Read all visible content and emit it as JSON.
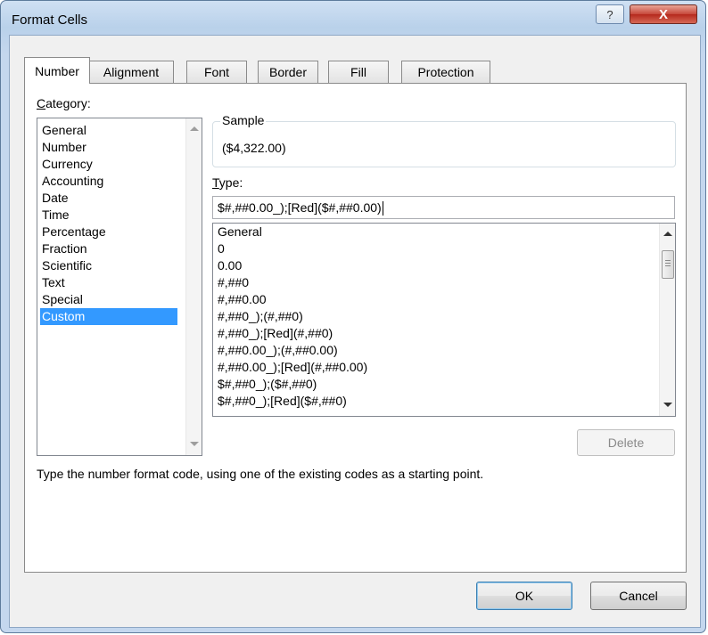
{
  "window": {
    "title": "Format Cells",
    "help_label": "?",
    "close_label": "X"
  },
  "tabs": [
    {
      "label": "Number",
      "active": true
    },
    {
      "label": "Alignment"
    },
    {
      "label": "Font"
    },
    {
      "label": "Border"
    },
    {
      "label": "Fill"
    },
    {
      "label": "Protection"
    }
  ],
  "category": {
    "label_hotkey": "C",
    "label_rest": "ategory:",
    "items": [
      "General",
      "Number",
      "Currency",
      "Accounting",
      "Date",
      "Time",
      "Percentage",
      "Fraction",
      "Scientific",
      "Text",
      "Special",
      "Custom"
    ],
    "selected": "Custom"
  },
  "sample": {
    "label": "Sample",
    "value": "($4,322.00)"
  },
  "type": {
    "label_hotkey": "T",
    "label_rest": "ype:",
    "value": "$#,##0.00_);[Red]($#,##0.00)"
  },
  "formats": [
    "General",
    "0",
    "0.00",
    "#,##0",
    "#,##0.00",
    "#,##0_);(#,##0)",
    "#,##0_);[Red](#,##0)",
    "#,##0.00_);(#,##0.00)",
    "#,##0.00_);[Red](#,##0.00)",
    "$#,##0_);($#,##0)",
    "$#,##0_);[Red]($#,##0)"
  ],
  "delete_label": "Delete",
  "description": "Type the number format code, using one of the existing codes as a starting point.",
  "buttons": {
    "ok": "OK",
    "cancel": "Cancel"
  },
  "colors": {
    "selection": "#3399ff",
    "close_button": "#c6473a"
  }
}
